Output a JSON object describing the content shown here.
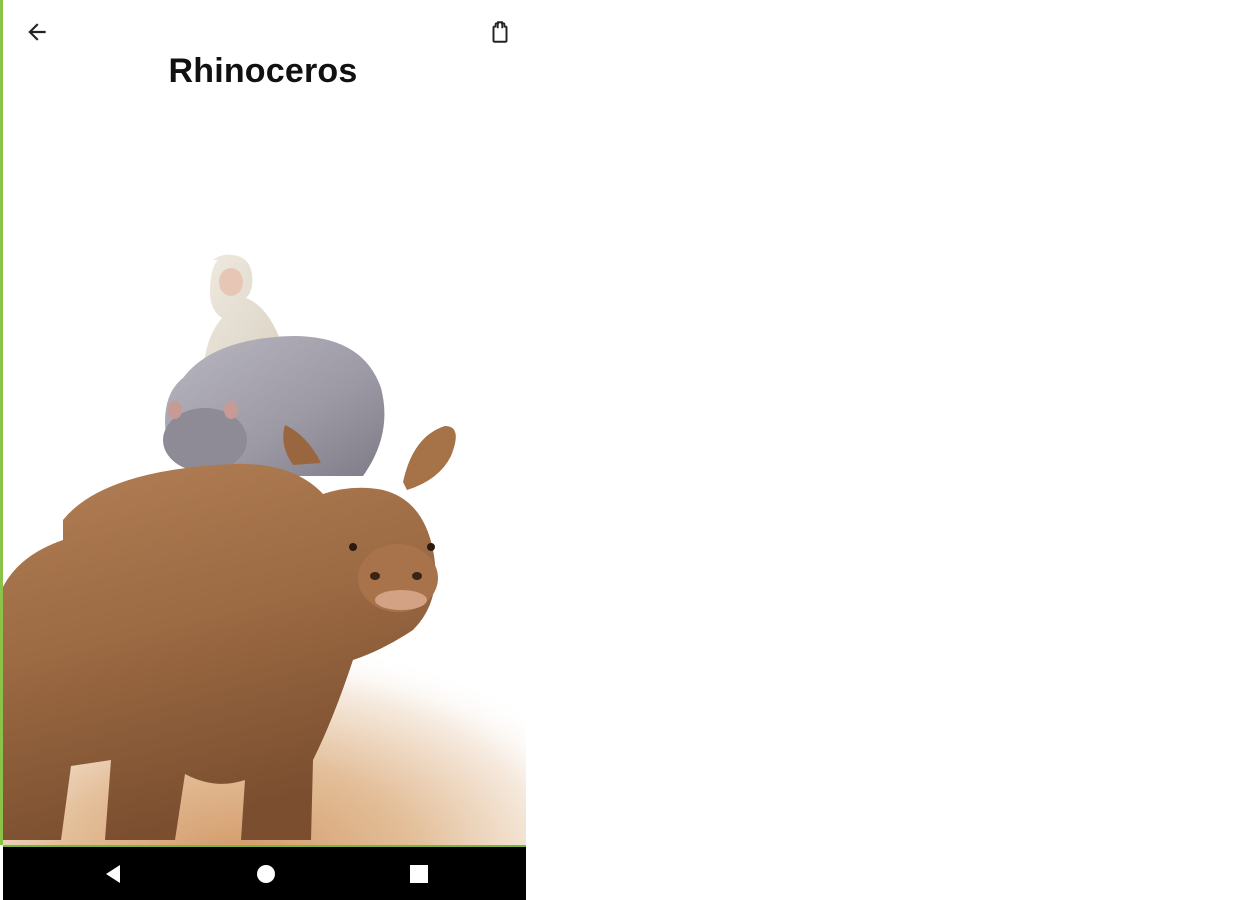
{
  "header": {
    "title": "Rhinoceros",
    "back_icon": "arrow-left-icon",
    "share_icon": "share-icon"
  },
  "scene": {
    "animals": [
      "monkey",
      "hippopotamus",
      "rhinoceros"
    ],
    "ground_color": "#d8a77c"
  },
  "nav_bar": {
    "back_icon": "triangle-back-icon",
    "home_icon": "circle-home-icon",
    "recents_icon": "square-recents-icon"
  },
  "colors": {
    "accent": "#8bc34a",
    "nav_background": "#000000",
    "title": "#111111"
  }
}
